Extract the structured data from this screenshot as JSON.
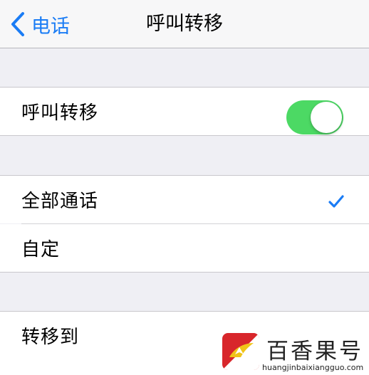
{
  "navbar": {
    "back_label": "电话",
    "title": "呼叫转移"
  },
  "call_forwarding": {
    "label": "呼叫转移",
    "enabled": true,
    "toggle_color": "#4cd964"
  },
  "scope_options": [
    {
      "label": "全部通话",
      "selected": true
    },
    {
      "label": "自定",
      "selected": false
    }
  ],
  "forward_to": {
    "label": "转移到"
  },
  "watermark": {
    "brand": "百香果号",
    "url": "huangjinbaixiangguo.com"
  },
  "colors": {
    "accent": "#1a7cf5",
    "background": "#efeff4",
    "checkmark": "#1a7cf5",
    "logo_red": "#d8262b"
  }
}
